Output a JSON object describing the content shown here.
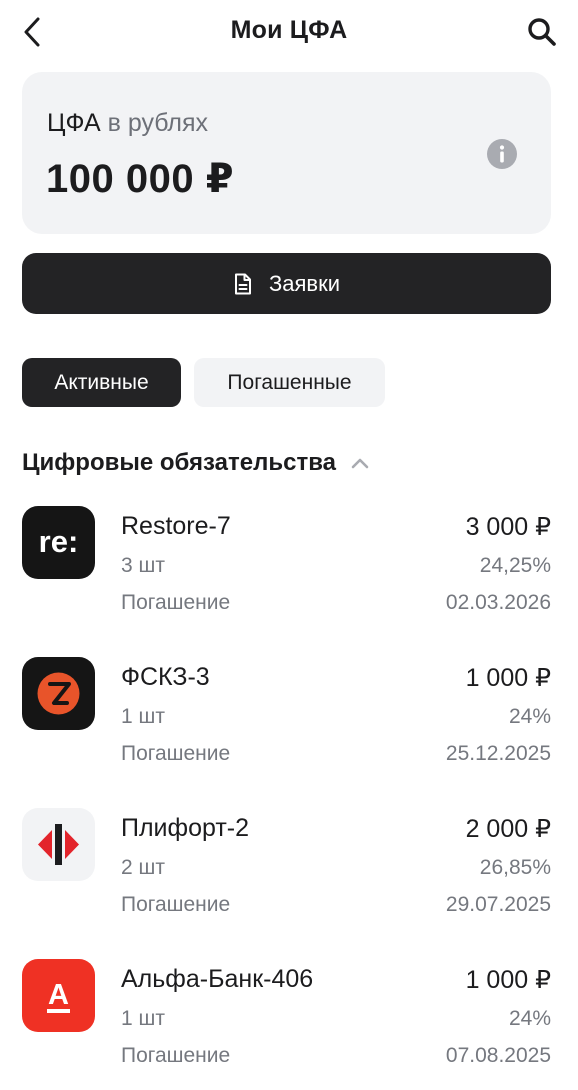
{
  "header": {
    "title": "Мои ЦФА",
    "back_icon": "chevron-left-icon",
    "search_icon": "search-icon"
  },
  "balance": {
    "label_main": "ЦФА",
    "label_rest": "в рублях",
    "amount": "100 000 ₽",
    "info_icon": "info-icon"
  },
  "orders_button": {
    "label": "Заявки",
    "icon": "document-icon"
  },
  "tabs": [
    {
      "label": "Активные",
      "selected": true
    },
    {
      "label": "Погашенные",
      "selected": false
    }
  ],
  "section": {
    "title": "Цифровые обязательства",
    "icon": "chevron-up-icon"
  },
  "assets": [
    {
      "name": "Restore-7",
      "amount": "3 000 ₽",
      "qty": "3 шт",
      "yield": "24,25%",
      "maturity_label": "Погашение",
      "maturity_date": "02.03.2026",
      "logo_text": "re:",
      "logo_color": "#151515"
    },
    {
      "name": "ФСКЗ-3",
      "amount": "1 000 ₽",
      "qty": "1 шт",
      "yield": "24%",
      "maturity_label": "Погашение",
      "maturity_date": "25.12.2025",
      "logo_color": "#151515",
      "logo_accent": "#e8542a"
    },
    {
      "name": "Плифорт-2",
      "amount": "2 000 ₽",
      "qty": "2 шт",
      "yield": "26,85%",
      "maturity_label": "Погашение",
      "maturity_date": "29.07.2025",
      "logo_color": "#f2f3f5",
      "logo_accent": "#e3242b"
    },
    {
      "name": "Альфа-Банк-406",
      "amount": "1 000 ₽",
      "qty": "1 шт",
      "yield": "24%",
      "maturity_label": "Погашение",
      "maturity_date": "07.08.2025",
      "logo_text": "А",
      "logo_color": "#ef3124"
    }
  ]
}
